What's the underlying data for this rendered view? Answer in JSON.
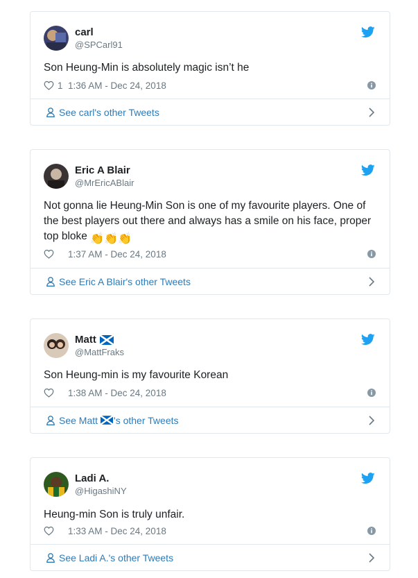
{
  "brand": {
    "link_color": "#2b7bb9",
    "bird_color": "#1da1f2",
    "muted_color": "#697882"
  },
  "tweets": [
    {
      "name": "carl",
      "handle": "@SPCarl91",
      "text": "Son Heung-Min is absolutely magic isn’t he",
      "likes": "1",
      "timestamp": "1:36 AM - Dec 24, 2018",
      "footer": "See carl's other Tweets",
      "icon": "heart-icon"
    },
    {
      "name": "Eric A Blair",
      "handle": "@MrEricABlair",
      "text": "Not gonna lie Heung-Min Son is one of my favourite players. One of the best players out there and always has a smile on his face, proper top bloke",
      "emoji": "👏👏👏",
      "likes": "",
      "timestamp": "1:37 AM - Dec 24, 2018",
      "footer": "See Eric A Blair's other Tweets"
    },
    {
      "name": "Matt",
      "handle": "@MattFraks",
      "text": "Son Heung-min is my favourite Korean",
      "likes": "",
      "timestamp": "1:38 AM - Dec 24, 2018",
      "footer_pre": "See Matt",
      "footer_post": "'s other Tweets",
      "flag": "scotland-flag"
    },
    {
      "name": "Ladi A.",
      "handle": "@HigashiNY",
      "text": "Heung-min Son is truly unfair.",
      "likes": "",
      "timestamp": "1:33 AM - Dec 24, 2018",
      "footer": "See Ladi A.'s other Tweets"
    }
  ]
}
